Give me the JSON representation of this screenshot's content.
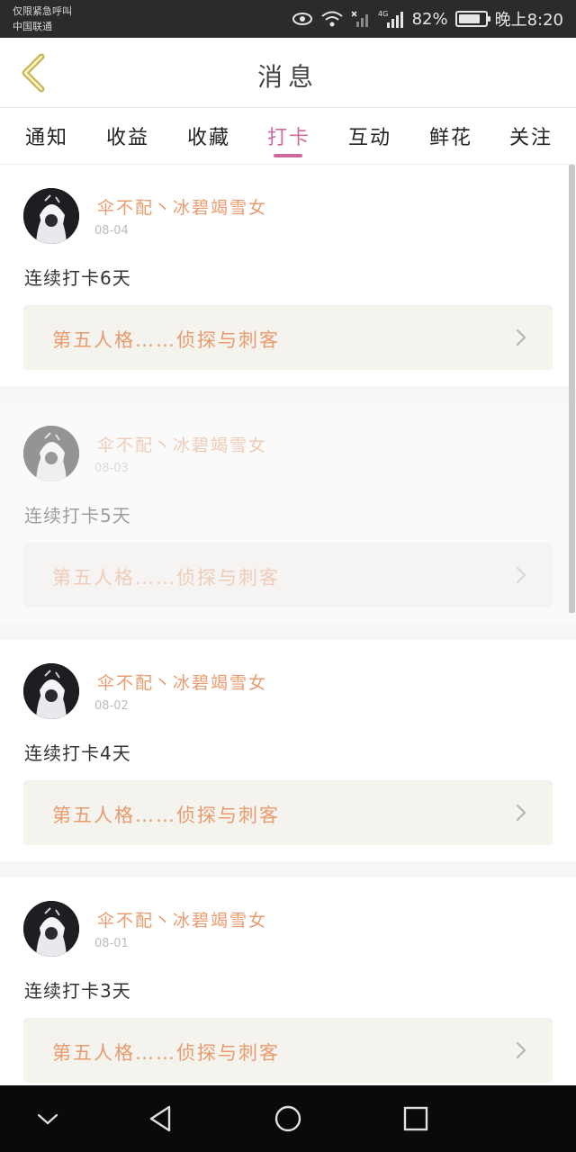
{
  "status_bar": {
    "carrier_line1": "仅限紧急呼叫",
    "carrier_line2": "中国联通",
    "network_label": "4G",
    "battery_percent": "82%",
    "battery_level": 0.82,
    "time": "晚上8:20"
  },
  "header": {
    "title": "消息"
  },
  "tabs": [
    {
      "label": "通知",
      "active": false
    },
    {
      "label": "收益",
      "active": false
    },
    {
      "label": "收藏",
      "active": false
    },
    {
      "label": "打卡",
      "active": true
    },
    {
      "label": "互动",
      "active": false
    },
    {
      "label": "鲜花",
      "active": false
    },
    {
      "label": "关注",
      "active": false
    }
  ],
  "colors": {
    "accent_pink": "#d06a9a",
    "username_orange": "#e89b6f",
    "topic_bg": "#f4f3ee"
  },
  "feed": [
    {
      "username": "伞不配丶冰碧竭雪女",
      "date": "08-04",
      "text": "连续打卡6天",
      "topic": "第五人格……侦探与刺客"
    },
    {
      "username": "伞不配丶冰碧竭雪女",
      "date": "08-03",
      "text": "连续打卡5天",
      "topic": "第五人格……侦探与刺客"
    },
    {
      "username": "伞不配丶冰碧竭雪女",
      "date": "08-02",
      "text": "连续打卡4天",
      "topic": "第五人格……侦探与刺客"
    },
    {
      "username": "伞不配丶冰碧竭雪女",
      "date": "08-01",
      "text": "连续打卡3天",
      "topic": "第五人格……侦探与刺客"
    }
  ],
  "icons": {
    "back": "back-chevron-icon",
    "topic_arrow": "chevron-right-icon",
    "nav": [
      "nav-down-icon",
      "nav-back-icon",
      "nav-home-icon",
      "nav-recents-icon"
    ]
  }
}
